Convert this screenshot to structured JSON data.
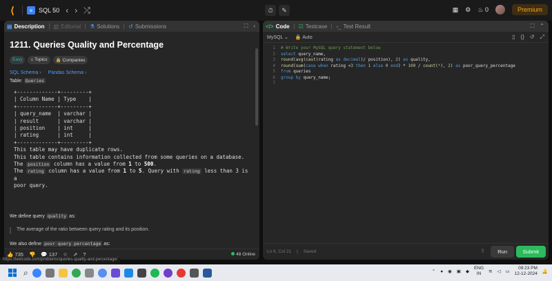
{
  "topbar": {
    "problem_list_label": "SQL 50",
    "prev_icon": "chevron-left-icon",
    "next_icon": "chevron-right-icon",
    "shuffle_icon": "shuffle-icon",
    "streak_count": "0",
    "premium_label": "Premium"
  },
  "left_tabs": {
    "description": "Description",
    "editorial": "Editorial",
    "solutions": "Solutions",
    "submissions": "Submissions"
  },
  "problem": {
    "title": "1211. Queries Quality and Percentage",
    "difficulty": "Easy",
    "topics": "Topics",
    "companies": "Companies",
    "sql_schema": "SQL Schema",
    "pandas_schema": "Pandas Schema",
    "table_prefix": "Table:",
    "table_name": "Queries",
    "schema_text": "+-------------+---------+\n| Column Name | Type    |\n+-------------+---------+\n| query_name  | varchar |\n| result      | varchar |\n| position    | int     |\n| rating      | int     |\n+-------------+---------+",
    "desc1": "This table may have duplicate rows.",
    "desc2": "This table contains information collected from some queries on a database.",
    "desc3_pre": "The",
    "desc3_code": "position",
    "desc3_mid": "column has a value from",
    "desc3_a": "1",
    "desc3_to": "to",
    "desc3_b": "500",
    "desc4_pre": "The",
    "desc4_code": "rating",
    "desc4_mid": "column has a value from",
    "desc4_a": "1",
    "desc4_to": "to",
    "desc4_b": "5",
    "desc4_post": "Query with",
    "desc4_code2": "rating",
    "desc4_end": "less than 3 is a",
    "desc5": "poor query.",
    "define1_pre": "We define query",
    "define1_code": "quality",
    "define1_post": "as:",
    "quote1": "The average of the ratio between query rating and its position.",
    "define2_pre": "We also define",
    "define2_code": "poor query percentage",
    "define2_post": "as:"
  },
  "left_footer": {
    "likes": "735",
    "comments": "137",
    "online": "48 Online"
  },
  "status_url": "https://leetcode.com/problems/queries-quality-and-percentage/",
  "right_tabs": {
    "code": "Code",
    "testcase": "Testcase",
    "test_result": "Test Result"
  },
  "editor": {
    "language": "MySQL",
    "auto": "Auto",
    "line_numbers": [
      "1",
      "2",
      "3",
      "4",
      "5",
      "6",
      "7"
    ],
    "cursor_position": "Ln 6, Col 21",
    "saved": "Saved",
    "run_label": "Run",
    "submit_label": "Submit"
  },
  "taskbar": {
    "lang": "ENG",
    "region": "IN",
    "time": "09:23 PM",
    "date": "12-12-2024"
  },
  "colors": {
    "accent": "#ffa116",
    "submit": "#2cbb5d",
    "link": "#4a9eff"
  }
}
